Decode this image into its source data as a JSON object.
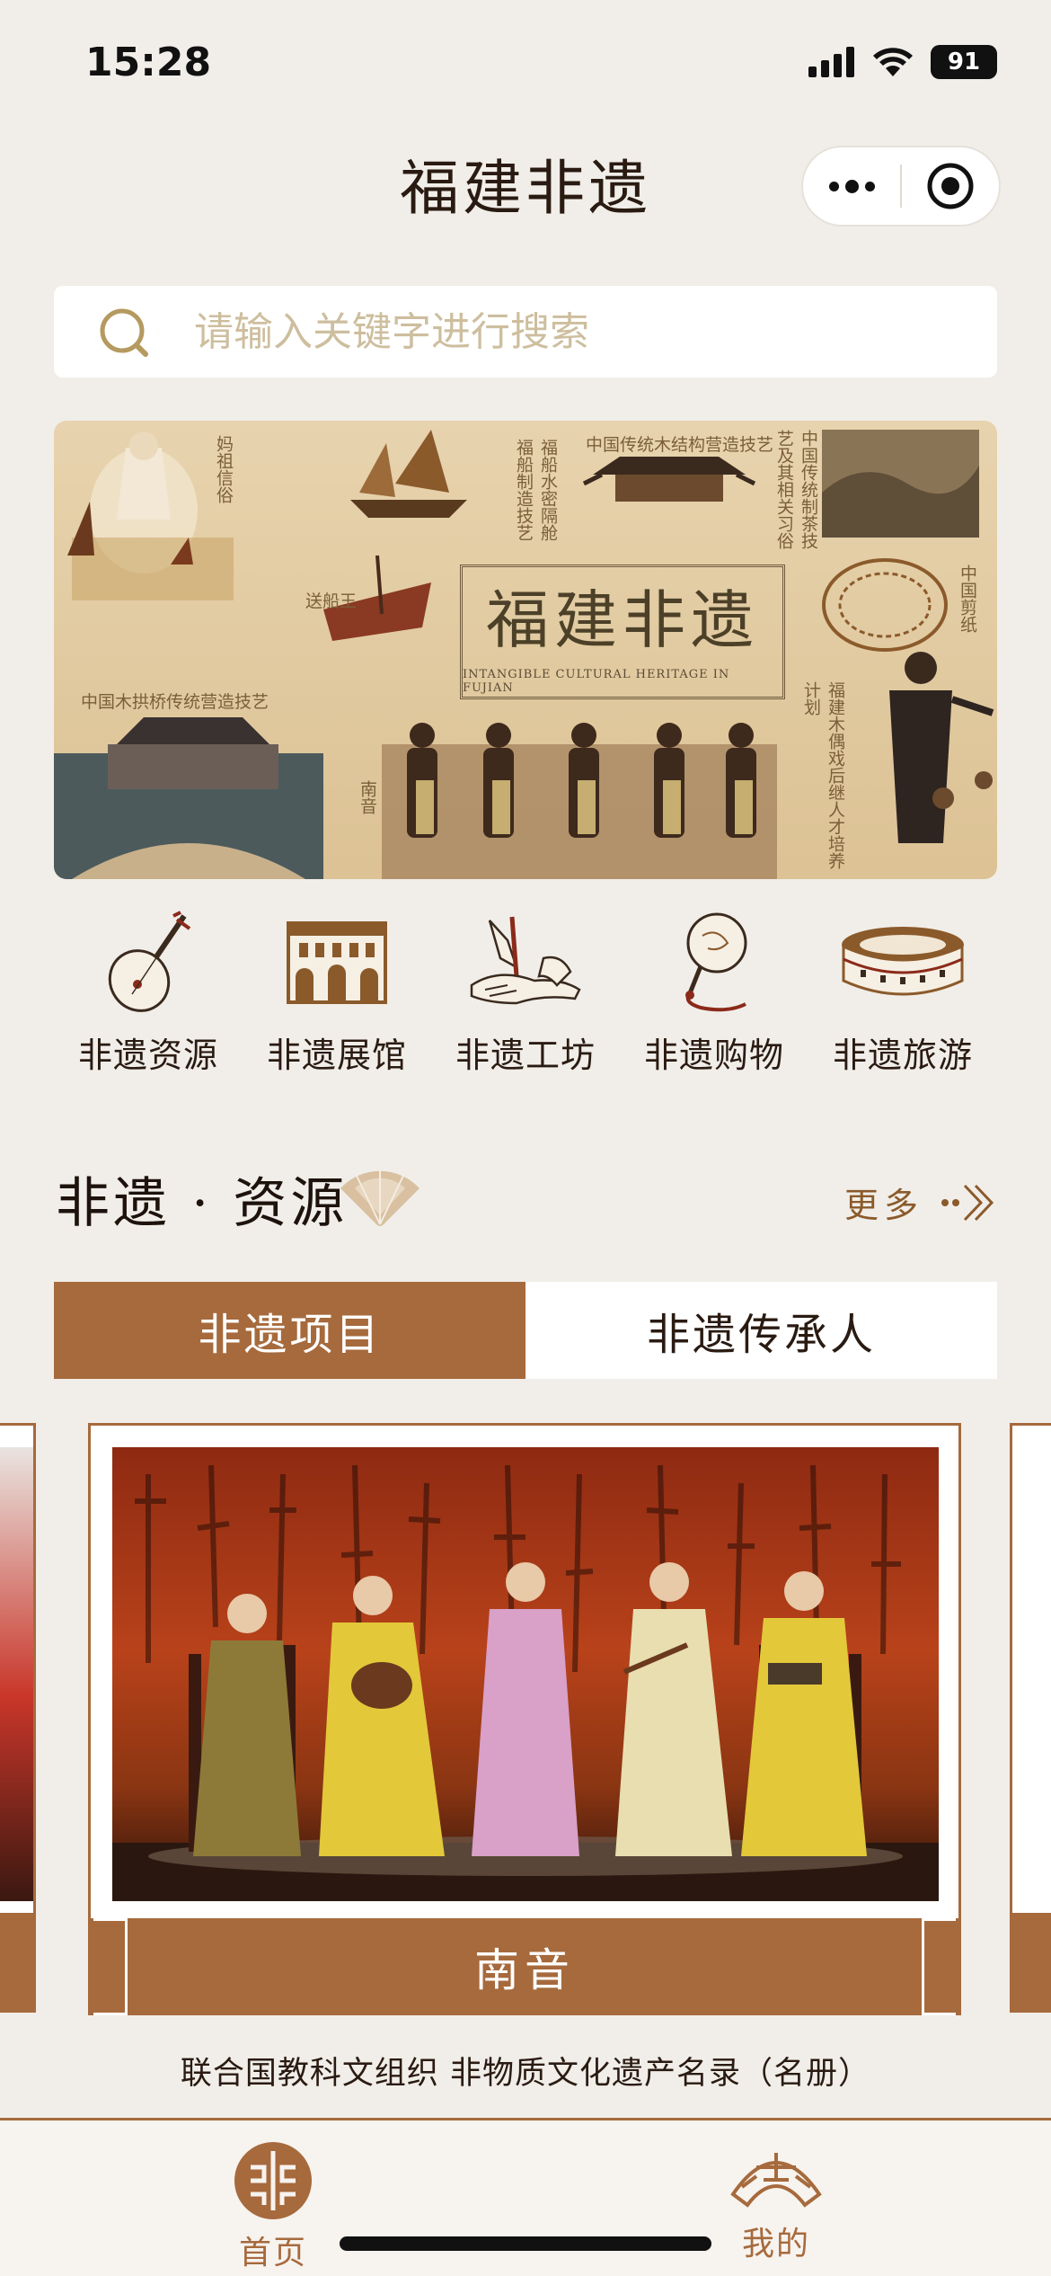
{
  "status_bar": {
    "time": "15:28",
    "battery": "91"
  },
  "header": {
    "title": "福建非遗"
  },
  "search": {
    "placeholder": "请输入关键字进行搜索"
  },
  "banner": {
    "title": "福建非遗",
    "subtitle": "INTANGIBLE CULTURAL HERITAGE IN FUJIAN",
    "captions": {
      "mazu": "妈祖信俗",
      "songwang": "送船王",
      "shipbuilding": "福船水密隔舱福船制造技艺",
      "wooden_arch": "中国传统木结构营造技艺",
      "tea": "中国传统制茶技艺及其相关习俗",
      "papercut": "中国剪纸",
      "bridge": "中国木拱桥传统营造技艺",
      "nanyin": "南音",
      "puppet": "福建木偶戏后继人才培养计划"
    }
  },
  "categories": [
    {
      "label": "非遗资源",
      "icon": "pipa-icon"
    },
    {
      "label": "非遗展馆",
      "icon": "museum-icon"
    },
    {
      "label": "非遗工坊",
      "icon": "calligraphy-hands-icon"
    },
    {
      "label": "非遗购物",
      "icon": "fan-icon"
    },
    {
      "label": "非遗旅游",
      "icon": "tulou-icon"
    }
  ],
  "section": {
    "title": "非遗 · 资源",
    "more": "更多"
  },
  "tabs": [
    {
      "label": "非遗项目",
      "active": true
    },
    {
      "label": "非遗传承人",
      "active": false
    }
  ],
  "card": {
    "title": "南音",
    "caption": "联合国教科文组织 非物质文化遗产名录（名册）"
  },
  "nav": {
    "home": "首页",
    "mine": "我的"
  },
  "colors": {
    "accent": "#A66A3D",
    "background": "#F1EEE9",
    "banner": "#E2CBA3"
  }
}
